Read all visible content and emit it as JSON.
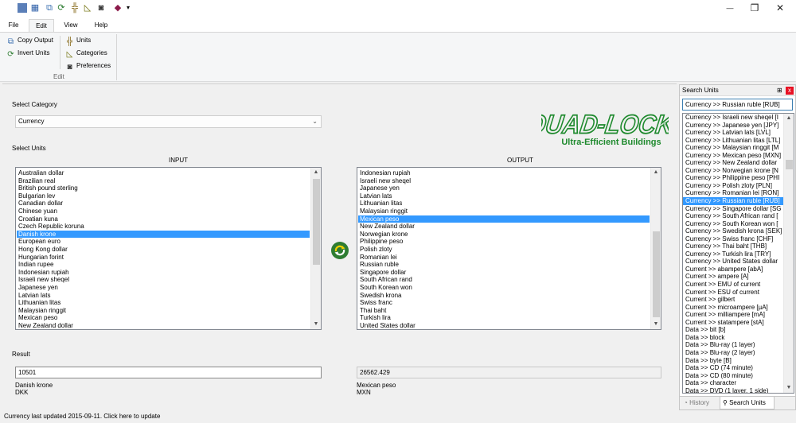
{
  "title_bar": {
    "quick_access_icons": [
      "notes-icon",
      "table-icon",
      "copy-icon",
      "refresh-icon",
      "units-icon",
      "categories-icon",
      "preferences-icon",
      "book-icon"
    ],
    "dropdown_glyph": "▾",
    "minimize_glyph": "—",
    "restore_glyph": "❐",
    "close_glyph": "✕"
  },
  "menu": {
    "tabs": [
      "File",
      "Edit",
      "View",
      "Help"
    ],
    "active": "Edit"
  },
  "ribbon": {
    "copy_output": "Copy Output",
    "invert_units": "Invert Units",
    "units": "Units",
    "categories": "Categories",
    "preferences": "Preferences",
    "group_label": "Edit"
  },
  "main": {
    "select_category_label": "Select Category",
    "category_value": "Currency",
    "select_units_label": "Select Units",
    "input_header": "INPUT",
    "output_header": "OUTPUT",
    "input_list": [
      "Australian dollar",
      "Brazilian real",
      "British pound sterling",
      "Bulgarian lev",
      "Canadian dollar",
      "Chinese yuan",
      "Croatian kuna",
      "Czech Republic koruna",
      "Danish krone",
      "European euro",
      "Hong Kong dollar",
      "Hungarian forint",
      "Indian rupee",
      "Indonesian rupiah",
      "Israeli new sheqel",
      "Japanese yen",
      "Latvian lats",
      "Lithuanian litas",
      "Malaysian ringgit",
      "Mexican peso",
      "New Zealand dollar"
    ],
    "input_selected": "Danish krone",
    "output_list": [
      "Indonesian rupiah",
      "Israeli new sheqel",
      "Japanese yen",
      "Latvian lats",
      "Lithuanian litas",
      "Malaysian ringgit",
      "Mexican peso",
      "New Zealand dollar",
      "Norwegian krone",
      "Philippine peso",
      "Polish zloty",
      "Romanian lei",
      "Russian ruble",
      "Singapore dollar",
      "South African rand",
      "South Korean won",
      "Swedish krona",
      "Swiss franc",
      "Thai baht",
      "Turkish lira",
      "United States dollar"
    ],
    "output_selected": "Mexican peso",
    "result_label": "Result",
    "input_value": "10501",
    "output_value": "26562.429",
    "input_unit_name": "Danish krone",
    "input_unit_code": "DKK",
    "output_unit_name": "Mexican peso",
    "output_unit_code": "MXN"
  },
  "logo": {
    "brand": "QUAD-LOCK",
    "registered": "®",
    "tagline": "Ultra-Efficient Buildings",
    "brand_color": "#1f8a2e"
  },
  "status_bar": {
    "text": "Currency last updated 2015-09-11. Click here to update"
  },
  "search_panel": {
    "title": "Search Units",
    "pin_glyph": "⊞",
    "close_glyph": "x",
    "query": "Currency >> Russian ruble [RUB]",
    "results": [
      "Currency >> Israeli new sheqel [I",
      "Currency >> Japanese yen [JPY]",
      "Currency >> Latvian lats [LVL]",
      "Currency >> Lithuanian litas [LTL]",
      "Currency >> Malaysian ringgit [M",
      "Currency >> Mexican peso [MXN]",
      "Currency >> New Zealand dollar",
      "Currency >> Norwegian krone [N",
      "Currency >> Philippine peso [PHI",
      "Currency >> Polish zloty [PLN]",
      "Currency >> Romanian lei [RON]",
      "Currency >> Russian ruble [RUB]",
      "Currency >> Singapore dollar [SG",
      "Currency >> South African rand [",
      "Currency >> South Korean won [",
      "Currency >> Swedish krona [SEK]",
      "Currency >> Swiss franc [CHF]",
      "Currency >> Thai baht [THB]",
      "Currency >> Turkish lira [TRY]",
      "Currency >> United States dollar",
      "Current >> abampere [abA]",
      "Current >> ampere [A]",
      "Current >> EMU of current",
      "Current >> ESU of current",
      "Current >> gilbert",
      "Current >> microampere [µA]",
      "Current >> milliampere [mA]",
      "Current >> statampere [stA]",
      "Data >> bit [b]",
      "Data >> block",
      "Data >> Blu-ray (1 layer)",
      "Data >> Blu-ray (2 layer)",
      "Data >> byte [B]",
      "Data >> CD (74 minute)",
      "Data >> CD (80 minute)",
      "Data >> character",
      "Data >> DVD (1 layer, 1 side)"
    ],
    "selected": "Currency >> Russian ruble [RUB]",
    "tab_history": "History",
    "tab_search": "Search Units"
  }
}
